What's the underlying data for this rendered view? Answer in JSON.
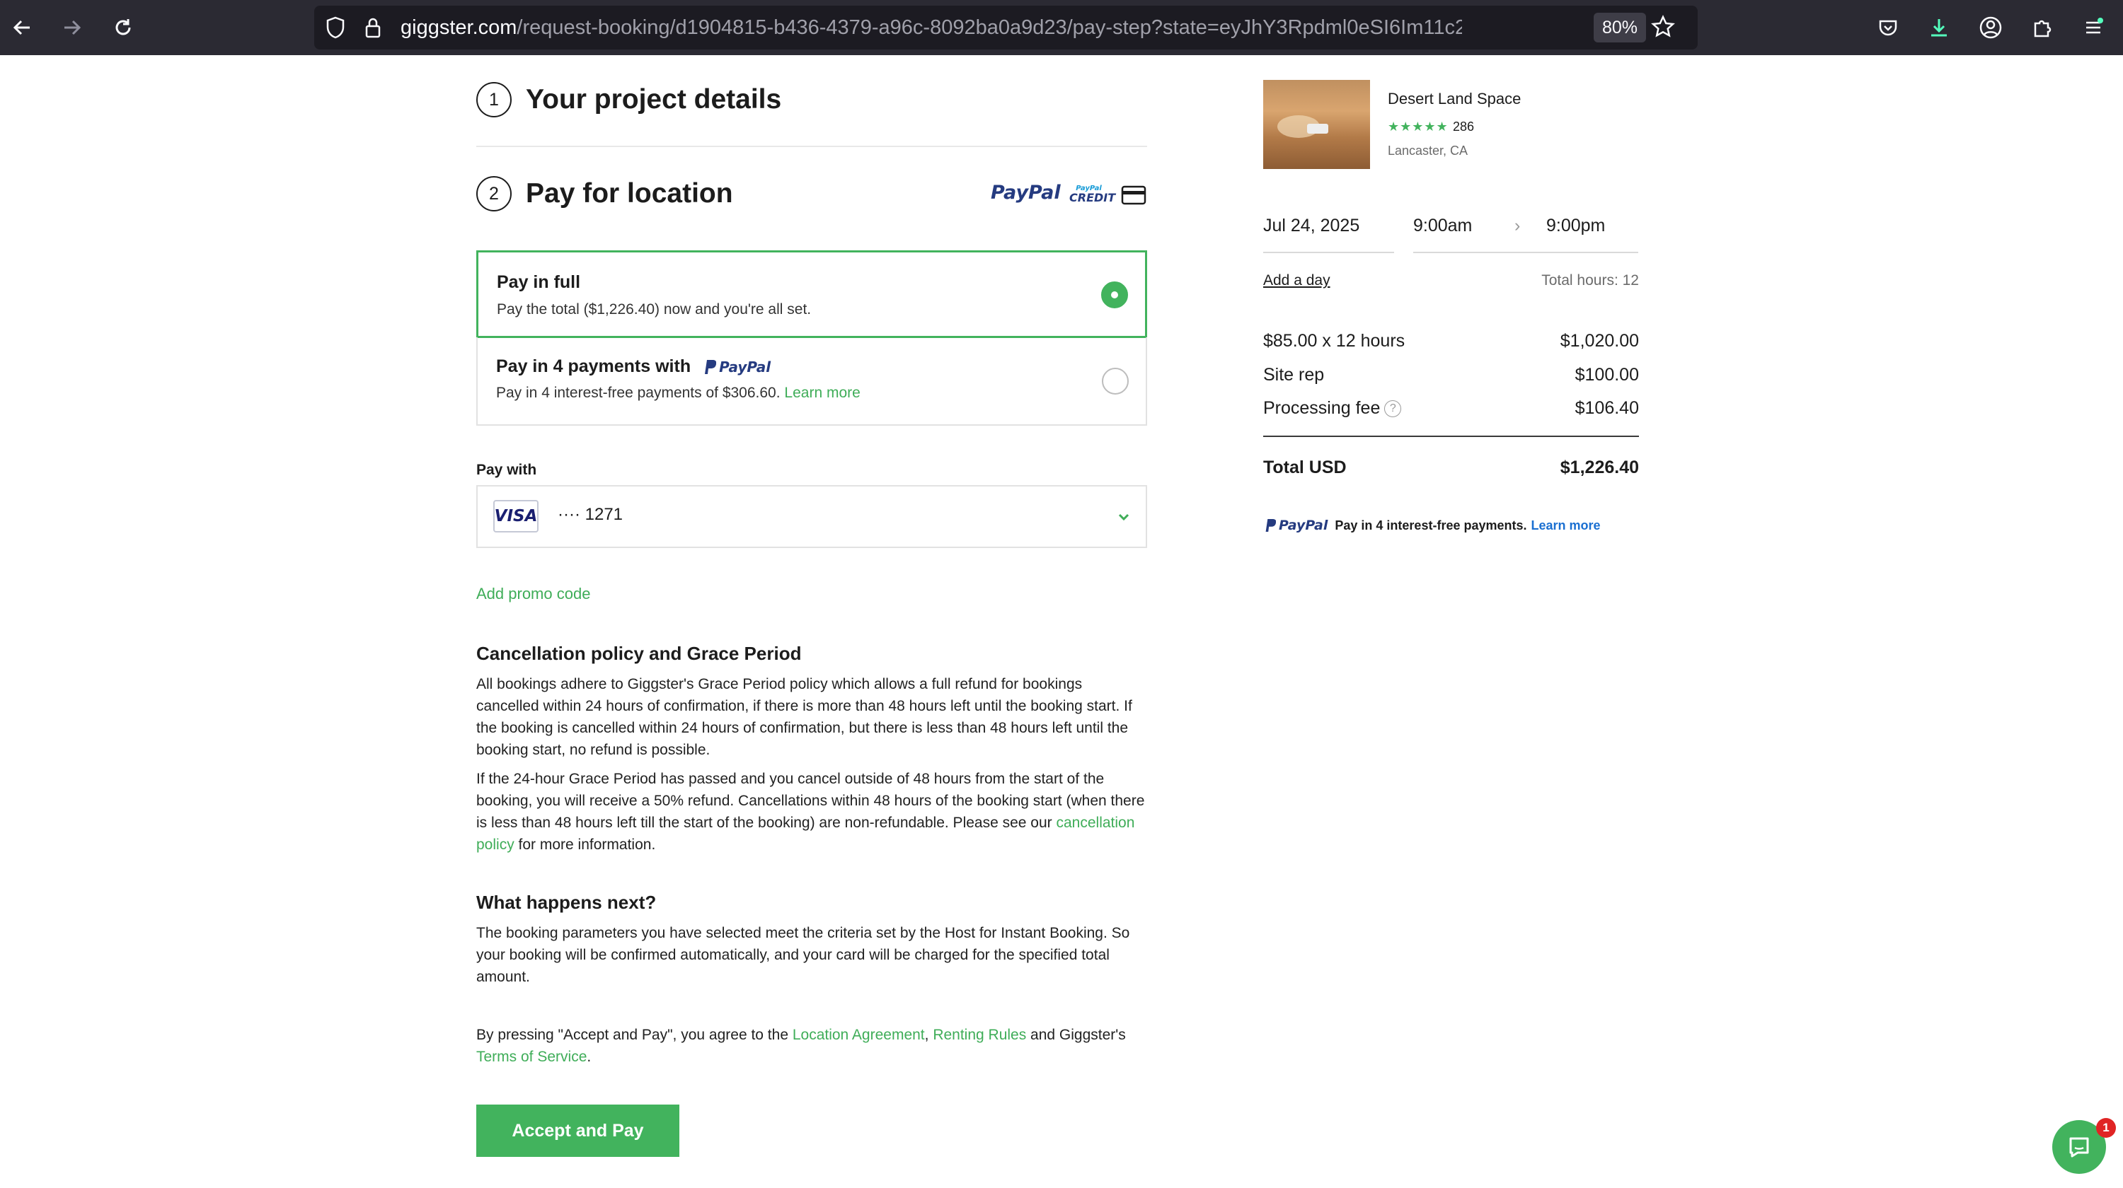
{
  "browser": {
    "url_domain": "giggster.com",
    "url_path": "/request-booking/d1904815-b436-4379-a96c-8092ba0a9d23/pay-step?state=eyJhY3Rpdml0eSI6Im11c2ljLXZpZGV",
    "zoom": "80%"
  },
  "steps": [
    {
      "number": "1",
      "title": "Your project details"
    },
    {
      "number": "2",
      "title": "Pay for location"
    }
  ],
  "payment_brands": {
    "paypal": "PayPal",
    "paypal_credit_top": "PayPal",
    "paypal_credit_bottom": "CREDIT"
  },
  "pay_options": {
    "full": {
      "title": "Pay in full",
      "desc": "Pay the total ($1,226.40) now and you're all set."
    },
    "four": {
      "title": "Pay in 4 payments with",
      "brand": "PayPal",
      "desc": "Pay in 4 interest-free payments of $306.60.",
      "learn_more": "Learn more"
    }
  },
  "pay_with": {
    "label": "Pay with",
    "card_brand": "VISA",
    "card_number": "···· 1271"
  },
  "promo": "Add promo code",
  "cancellation": {
    "heading": "Cancellation policy and Grace Period",
    "p1": "All bookings adhere to Giggster's Grace Period policy which allows a full refund for bookings cancelled within 24 hours of confirmation, if there is more than 48 hours left until the booking start. If the booking is cancelled within 24 hours of confirmation, but there is less than 48 hours left until the booking start, no refund is possible.",
    "p2_before": "If the 24-hour Grace Period has passed and you cancel outside of 48 hours from the start of the booking, you will receive a 50% refund. Cancellations within 48 hours of the booking start (when there is less than 48 hours left till the start of the booking) are non-refundable. Please see our ",
    "p2_link": "cancellation policy",
    "p2_after": " for more information."
  },
  "next": {
    "heading": "What happens next?",
    "text": "The booking parameters you have selected meet the criteria set by the Host for Instant Booking. So your booking will be confirmed automatically, and your card will be charged for the specified total amount."
  },
  "agreement": {
    "before": "By pressing \"Accept and Pay\", you agree to the ",
    "link1": "Location Agreement",
    "comma": ", ",
    "link2": "Renting Rules",
    "and": " and Giggster's ",
    "link3": "Terms of Service",
    "end": "."
  },
  "accept_button": "Accept and Pay",
  "listing": {
    "name": "Desert Land Space",
    "stars": "★★★★★",
    "rating_count": "286",
    "location": "Lancaster, CA"
  },
  "schedule": {
    "date": "Jul 24, 2025",
    "start": "9:00am",
    "arrow": "›",
    "end": "9:00pm",
    "add_day": "Add a day",
    "total_hours": "Total hours: 12"
  },
  "pricing": [
    {
      "label": "$85.00 x 12 hours",
      "amount": "$1,020.00"
    },
    {
      "label": "Site rep",
      "amount": "$100.00"
    },
    {
      "label": "Processing fee",
      "amount": "$106.40"
    }
  ],
  "total": {
    "label": "Total USD",
    "amount": "$1,226.40"
  },
  "paypal_note": {
    "brand": "PayPal",
    "text": "Pay in 4 interest-free payments.",
    "link": "Learn more"
  },
  "chat": {
    "badge": "1"
  },
  "colors": {
    "accent": "#42b35d",
    "paypal_dark": "#253b80",
    "paypal_light": "#179bd7",
    "chrome": "#2b2a33"
  }
}
